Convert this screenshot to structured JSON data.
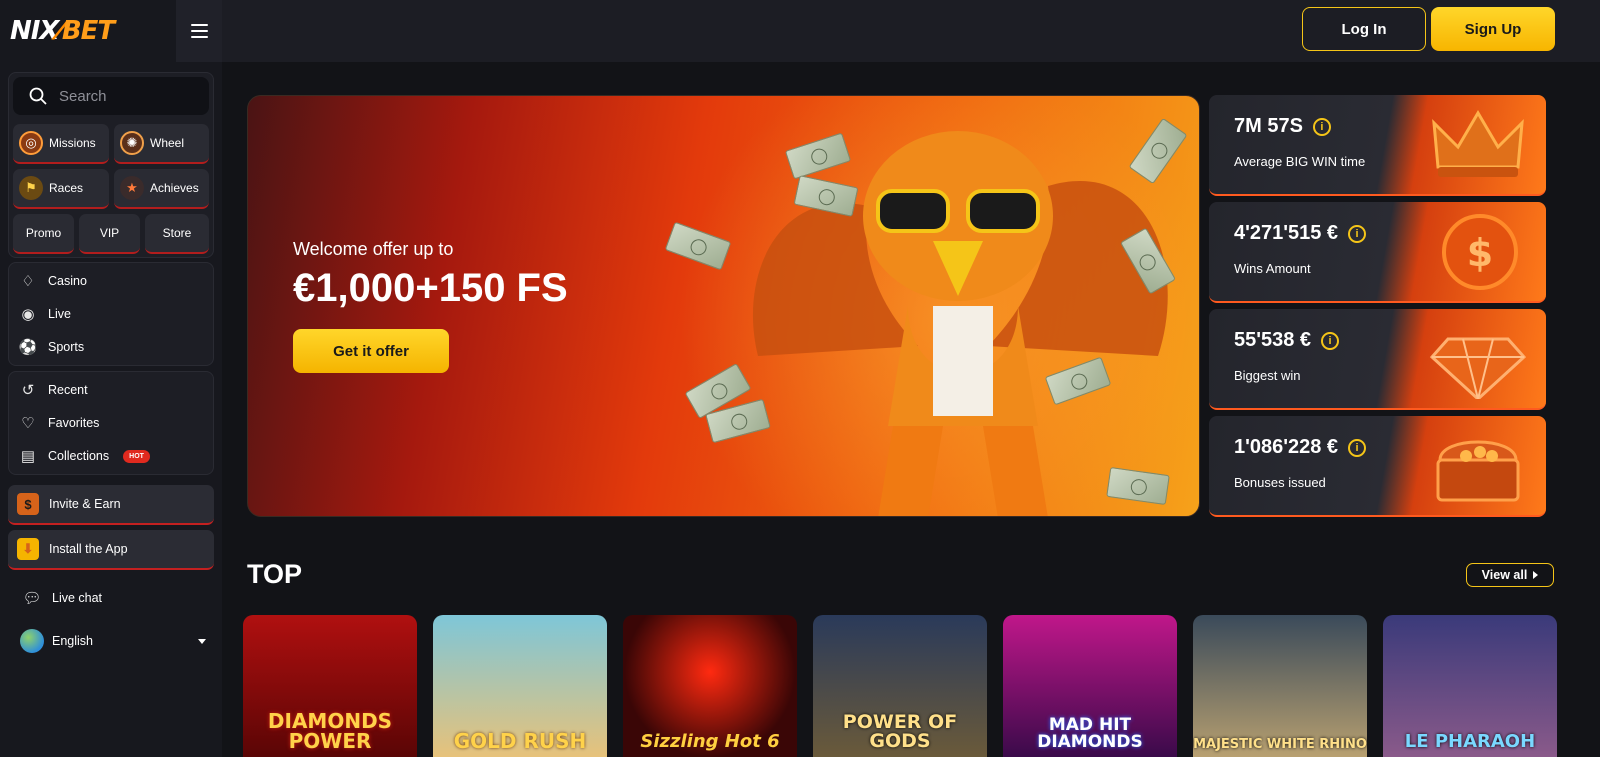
{
  "header": {
    "logo_nix": "NIX",
    "logo_bet": "BET",
    "login_label": "Log In",
    "signup_label": "Sign Up"
  },
  "sidebar": {
    "search_placeholder": "Search",
    "chips": [
      {
        "label": "Missions",
        "icon": "missions-icon"
      },
      {
        "label": "Wheel",
        "icon": "wheel-icon"
      },
      {
        "label": "Races",
        "icon": "races-icon"
      },
      {
        "label": "Achieves",
        "icon": "achieves-icon"
      },
      {
        "label": "Promo"
      },
      {
        "label": "VIP"
      },
      {
        "label": "Store"
      }
    ],
    "main_nav": [
      {
        "label": "Casino",
        "icon": "casino-icon"
      },
      {
        "label": "Live",
        "icon": "live-icon"
      },
      {
        "label": "Sports",
        "icon": "sports-icon"
      }
    ],
    "user_nav": [
      {
        "label": "Recent",
        "icon": "recent-icon"
      },
      {
        "label": "Favorites",
        "icon": "heart-icon"
      },
      {
        "label": "Collections",
        "icon": "book-icon",
        "badge": "HOT"
      }
    ],
    "invite_label": "Invite & Earn",
    "install_label": "Install the App",
    "live_chat_label": "Live chat",
    "language": "English"
  },
  "hero": {
    "subtitle": "Welcome offer up to",
    "title": "€1,000+150 FS",
    "cta_label": "Get it offer"
  },
  "stats": [
    {
      "value": "7M 57S",
      "label": "Average BIG WIN time",
      "icon": "crown-icon"
    },
    {
      "value": "4'271'515 €",
      "label": "Wins Amount",
      "icon": "coin-icon"
    },
    {
      "value": "55'538 €",
      "label": "Biggest win",
      "icon": "diamond-icon"
    },
    {
      "value": "1'086'228 €",
      "label": "Bonuses issued",
      "icon": "chest-icon"
    }
  ],
  "top_section": {
    "title": "TOP",
    "view_all_label": "View all",
    "games": [
      {
        "title": "DIAMONDS POWER"
      },
      {
        "title": "GOLD RUSH"
      },
      {
        "title": "Sizzling Hot 6"
      },
      {
        "title": "POWER OF GODS"
      },
      {
        "title": "MAD HIT DIAMONDS"
      },
      {
        "title": "MAJESTIC WHITE RHINO"
      },
      {
        "title": "LE PHARAOH"
      }
    ]
  },
  "colors": {
    "accent_yellow": "#f5c518",
    "brand_orange": "#ff8a00",
    "hot_red": "#e02a1f",
    "background": "#121317"
  }
}
